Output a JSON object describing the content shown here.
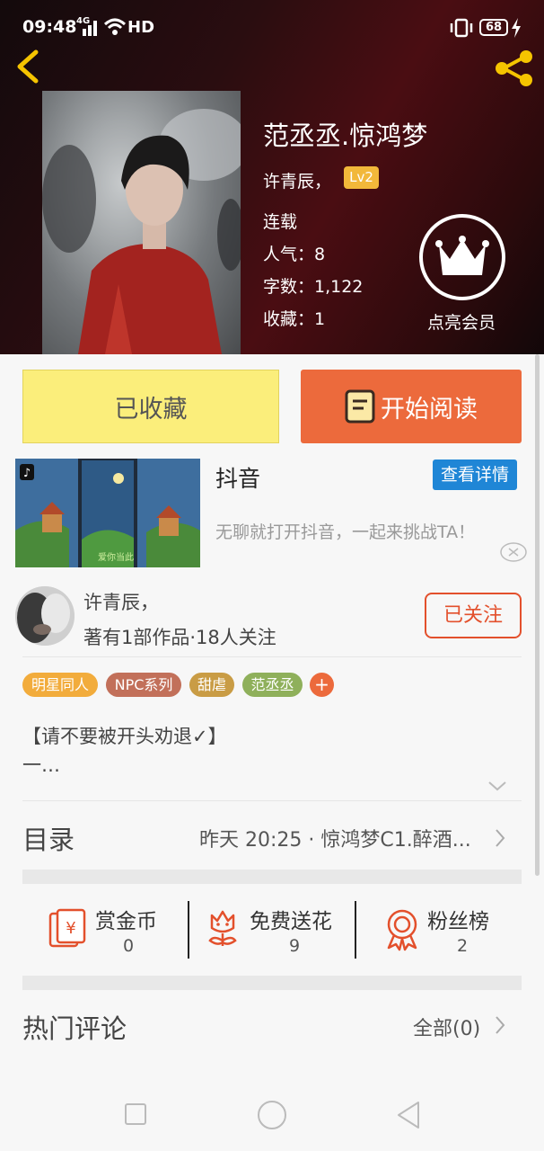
{
  "status_bar": {
    "time": "09:48",
    "network": "4G",
    "hd": "HD",
    "battery": "68"
  },
  "book": {
    "title": "范丞丞.惊鸿梦",
    "author": "许青辰，",
    "level": "Lv2",
    "state": "连载",
    "popularity": "人气：8",
    "words": "字数：1,122",
    "favorites": "收藏：1",
    "vip_label": "点亮会员"
  },
  "actions": {
    "collected": "已收藏",
    "read": "开始阅读"
  },
  "ad": {
    "name": "抖音",
    "detail_button": "查看详情",
    "description": "无聊就打开抖音，一起来挑战TA！",
    "game_text": "爱你当此"
  },
  "author_card": {
    "name": "许青辰，",
    "summary": "著有1部作品·18人关注",
    "follow_button": "已关注"
  },
  "tags": [
    {
      "label": "明星同人",
      "color": "#f2ac3c"
    },
    {
      "label": "NPC系列",
      "color": "#c2705a"
    },
    {
      "label": "甜虐",
      "color": "#c99c45"
    },
    {
      "label": "范丞丞",
      "color": "#8fb05b"
    },
    {
      "label": "+",
      "color": "#ec6a3c"
    }
  ],
  "intro": {
    "line1": "【请不要被开头劝退✓】",
    "line2": "一…"
  },
  "catalog": {
    "label": "目录",
    "latest": "昨天 20:25 · 惊鸿梦C1.醉酒..."
  },
  "stats": [
    {
      "label": "赏金币",
      "value": "0",
      "icon": "red-envelope-icon"
    },
    {
      "label": "免费送花",
      "value": "9",
      "icon": "flower-icon"
    },
    {
      "label": "粉丝榜",
      "value": "2",
      "icon": "medal-icon"
    }
  ],
  "comments": {
    "title": "热门评论",
    "all": "全部(0)"
  }
}
